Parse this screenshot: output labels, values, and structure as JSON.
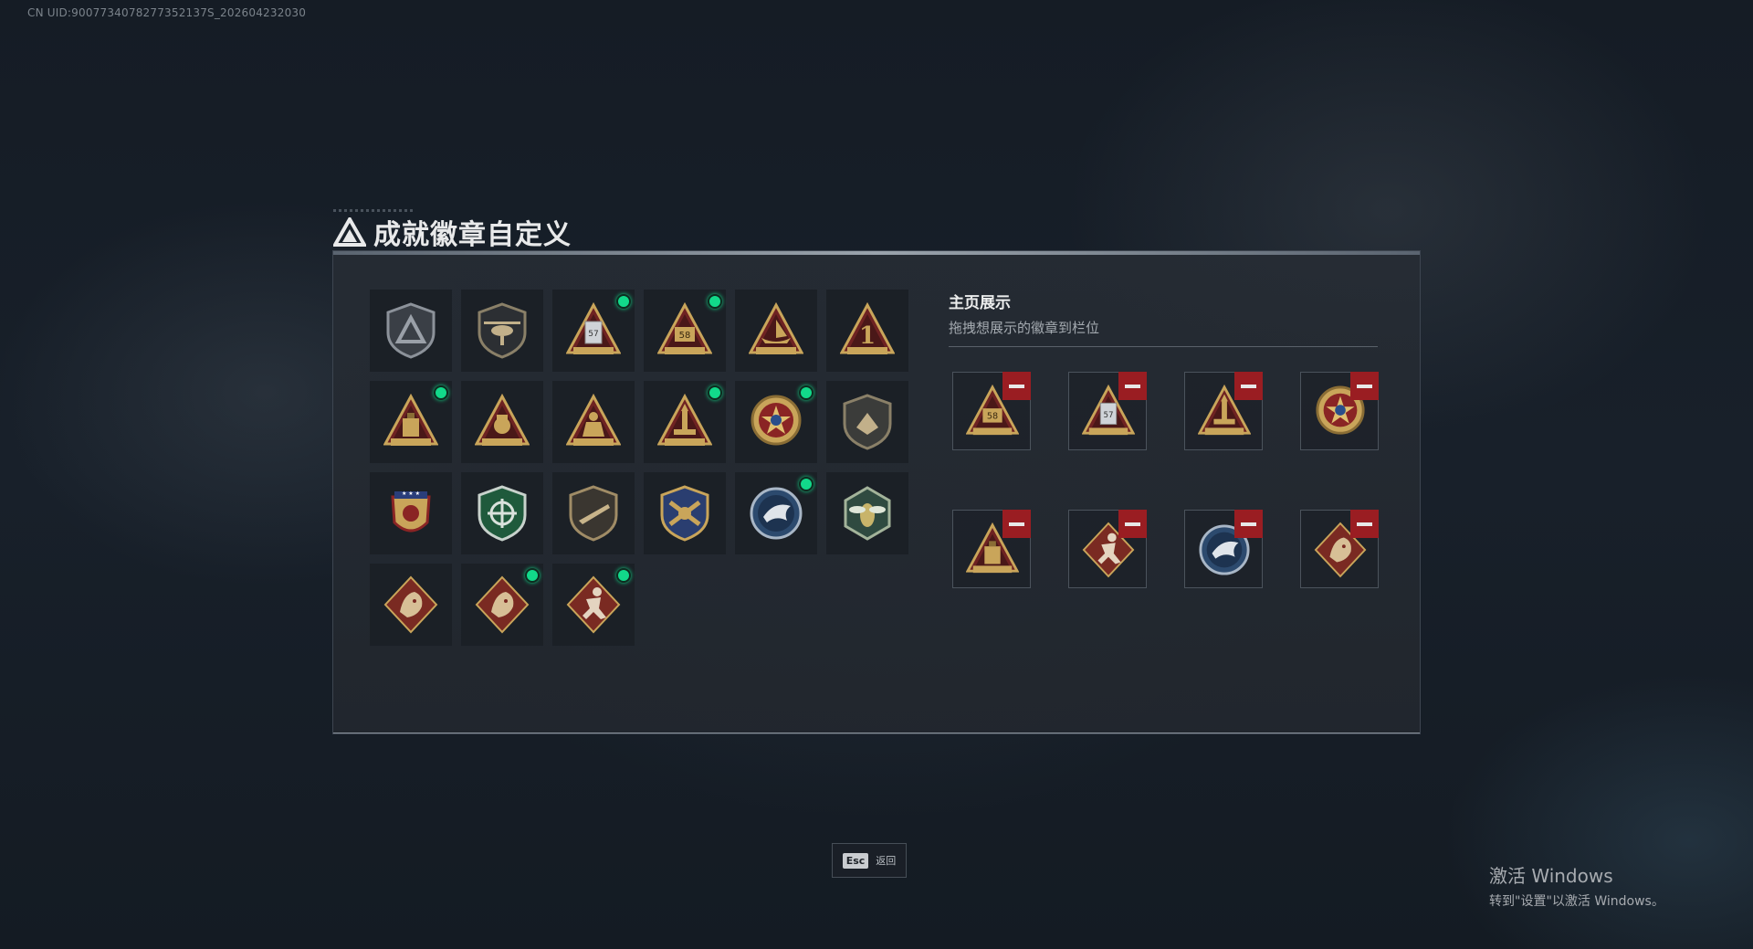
{
  "uid_text": "CN UID:9007734078277352137S_202604232030",
  "title": "成就徽章自定义",
  "showcase": {
    "title": "主页展示",
    "subtitle": "拖拽想展示的徽章到栏位"
  },
  "badges": [
    {
      "icon": "grey-shield-triangle-badge-icon",
      "new": false
    },
    {
      "icon": "helicopter-shield-badge-icon",
      "new": false
    },
    {
      "icon": "ticket-57-triangle-badge-icon",
      "new": true,
      "text": "57"
    },
    {
      "icon": "badge-58-triangle-icon",
      "new": true,
      "text": "58"
    },
    {
      "icon": "boat-triangle-badge-icon",
      "new": false
    },
    {
      "icon": "number-one-triangle-badge-icon",
      "new": false,
      "text": "1"
    },
    {
      "icon": "crate-triangle-badge-icon",
      "new": true
    },
    {
      "icon": "fist-triangle-badge-icon",
      "new": false
    },
    {
      "icon": "soldier-triangle-badge-icon",
      "new": false
    },
    {
      "icon": "rocket-triangle-badge-icon",
      "new": true
    },
    {
      "icon": "star-medal-badge-icon",
      "new": true
    },
    {
      "icon": "dark-shield-badge-icon",
      "new": false
    },
    {
      "icon": "eagle-crest-badge-icon",
      "new": false
    },
    {
      "icon": "green-crosshair-shield-badge-icon",
      "new": false
    },
    {
      "icon": "rifle-shield-badge-icon",
      "new": false
    },
    {
      "icon": "gold-crossed-guns-badge-icon",
      "new": false
    },
    {
      "icon": "eagle-round-badge-icon",
      "new": true
    },
    {
      "icon": "hornet-hexagon-badge-icon",
      "new": false
    },
    {
      "icon": "dragon-diamond-badge-icon",
      "new": false
    },
    {
      "icon": "dragon-diamond-badge-icon",
      "new": true
    },
    {
      "icon": "runner-diamond-badge-icon",
      "new": true
    }
  ],
  "showcase_slots": [
    {
      "icon": "badge-58-triangle-icon",
      "text": "58"
    },
    {
      "icon": "ticket-57-triangle-badge-icon",
      "text": "57"
    },
    {
      "icon": "rocket-triangle-badge-icon"
    },
    {
      "icon": "star-medal-badge-icon"
    },
    {
      "icon": "crate-triangle-badge-icon"
    },
    {
      "icon": "runner-diamond-badge-icon"
    },
    {
      "icon": "eagle-round-badge-icon"
    },
    {
      "icon": "dragon-diamond-badge-icon"
    }
  ],
  "esc": {
    "key": "Esc",
    "label": "返回"
  },
  "windows_watermark": {
    "line1": "激活 Windows",
    "line2": "转到\"设置\"以激活 Windows。"
  },
  "colors": {
    "accent_new_dot": "#12d98a",
    "remove_red": "#9a1d22",
    "gold": "#c9a55a",
    "maroon": "#6e2222"
  }
}
